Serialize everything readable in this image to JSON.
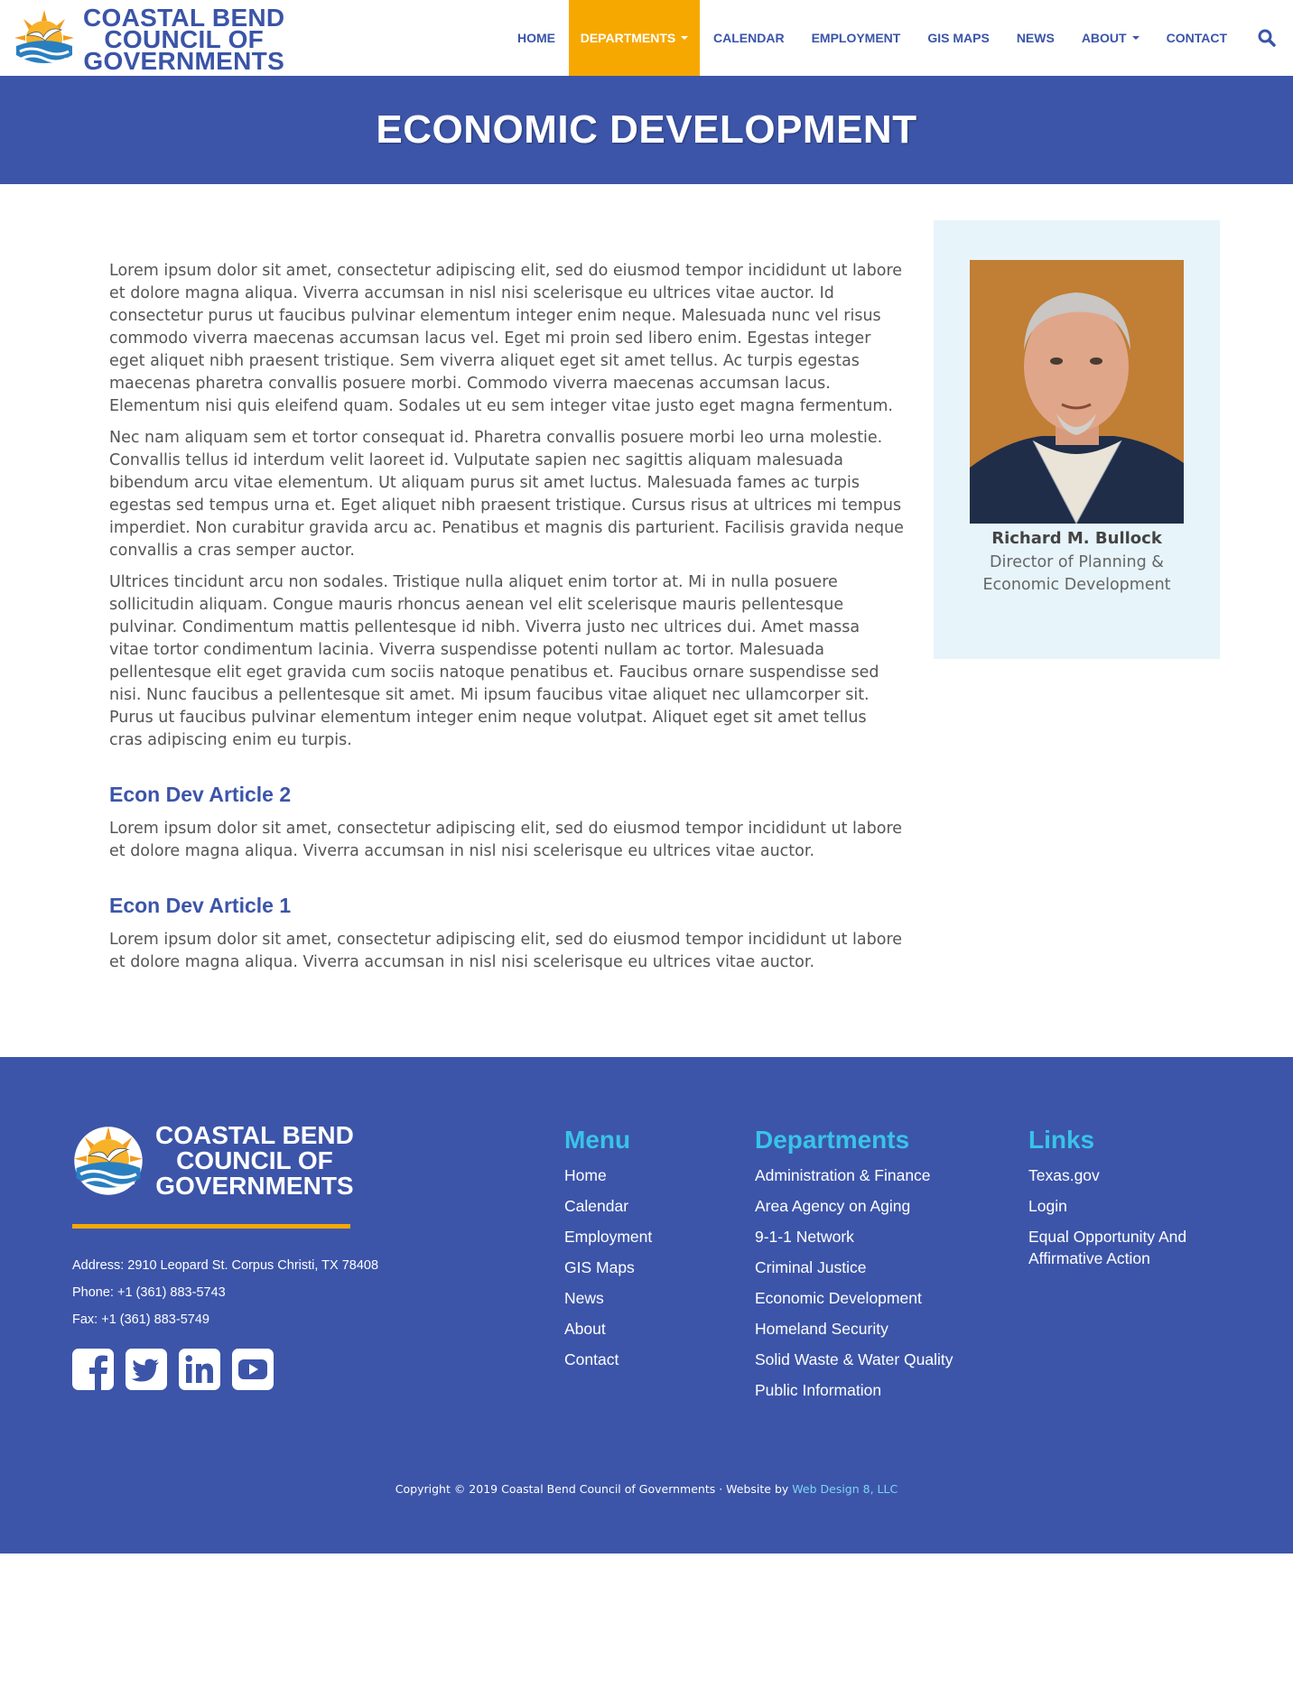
{
  "header": {
    "logo_lines": [
      "COASTAL BEND",
      "COUNCIL OF",
      "GOVERNMENTS"
    ],
    "nav": [
      "HOME",
      "DEPARTMENTS",
      "CALENDAR",
      "EMPLOYMENT",
      "GIS MAPS",
      "NEWS",
      "ABOUT",
      "CONTACT"
    ],
    "active_nav": "DEPARTMENTS"
  },
  "banner": {
    "title": "ECONOMIC DEVELOPMENT"
  },
  "content": {
    "paragraphs": [
      "Lorem ipsum dolor sit amet, consectetur adipiscing elit, sed do eiusmod tempor incididunt ut labore et dolore magna aliqua. Viverra accumsan in nisl nisi scelerisque eu ultrices vitae auctor. Id consectetur purus ut faucibus pulvinar elementum integer enim neque. Malesuada nunc vel risus commodo viverra maecenas accumsan lacus vel. Eget mi proin sed libero enim. Egestas integer eget aliquet nibh praesent tristique. Sem viverra aliquet eget sit amet tellus. Ac turpis egestas maecenas pharetra convallis posuere morbi. Commodo viverra maecenas accumsan lacus. Elementum nisi quis eleifend quam. Sodales ut eu sem integer vitae justo eget magna fermentum.",
      "Nec nam aliquam sem et tortor consequat id. Pharetra convallis posuere morbi leo urna molestie. Convallis tellus id interdum velit laoreet id. Vulputate sapien nec sagittis aliquam malesuada bibendum arcu vitae elementum. Ut aliquam purus sit amet luctus. Malesuada fames ac turpis egestas sed tempus urna et. Eget aliquet nibh praesent tristique. Cursus risus at ultrices mi tempus imperdiet. Non curabitur gravida arcu ac. Penatibus et magnis dis parturient. Facilisis gravida neque convallis a cras semper auctor.",
      "Ultrices tincidunt arcu non sodales. Tristique nulla aliquet enim tortor at. Mi in nulla posuere sollicitudin aliquam. Congue mauris rhoncus aenean vel elit scelerisque mauris pellentesque pulvinar. Condimentum mattis pellentesque id nibh. Viverra justo nec ultrices dui. Amet massa vitae tortor condimentum lacinia. Viverra suspendisse potenti nullam ac tortor. Malesuada pellentesque elit eget gravida cum sociis natoque penatibus et. Faucibus ornare suspendisse sed nisi. Nunc faucibus a pellentesque sit amet. Mi ipsum faucibus vitae aliquet nec ullamcorper sit. Purus ut faucibus pulvinar elementum integer enim neque volutpat. Aliquet eget sit amet tellus cras adipiscing enim eu turpis."
    ],
    "articles": [
      {
        "title": "Econ Dev Article 2",
        "body": "Lorem ipsum dolor sit amet, consectetur adipiscing elit, sed do eiusmod tempor incididunt ut labore et dolore magna aliqua. Viverra accumsan in nisl nisi scelerisque eu ultrices vitae auctor."
      },
      {
        "title": "Econ Dev Article 1",
        "body": "Lorem ipsum dolor sit amet, consectetur adipiscing elit, sed do eiusmod tempor incididunt ut labore et dolore magna aliqua. Viverra accumsan in nisl nisi scelerisque eu ultrices vitae auctor."
      }
    ]
  },
  "sidebar": {
    "name": "Richard M. Bullock",
    "title": "Director of Planning & Economic Development"
  },
  "footer": {
    "logo_lines": [
      "COASTAL BEND",
      "COUNCIL OF",
      "GOVERNMENTS"
    ],
    "address": "Address: 2910 Leopard St. Corpus Christi, TX 78408",
    "phone": "Phone: +1 (361) 883-5743",
    "fax": "Fax: +1 (361) 883-5749",
    "menu_title": "Menu",
    "menu": [
      "Home",
      "Calendar",
      "Employment",
      "GIS Maps",
      "News",
      "About",
      "Contact"
    ],
    "departments_title": "Departments",
    "departments": [
      "Administration & Finance",
      "Area Agency on Aging",
      "9-1-1 Network",
      "Criminal Justice",
      "Economic Development",
      "Homeland Security",
      "Solid Waste & Water Quality",
      "Public Information"
    ],
    "links_title": "Links",
    "links": [
      "Texas.gov",
      "Login",
      "Equal Opportunity And Affirmative Action"
    ],
    "copyright": "Copyright © 2019 Coastal Bend Council of Governments · Website by ",
    "credit": "Web Design 8, LLC",
    "social_icons": [
      "facebook-icon",
      "twitter-icon",
      "linkedin-icon",
      "youtube-icon"
    ]
  },
  "colors": {
    "primary": "#3c55a9",
    "accent": "#f7a800",
    "heading_light": "#39c3e8",
    "sidebar_bg": "#e7f4fa"
  }
}
